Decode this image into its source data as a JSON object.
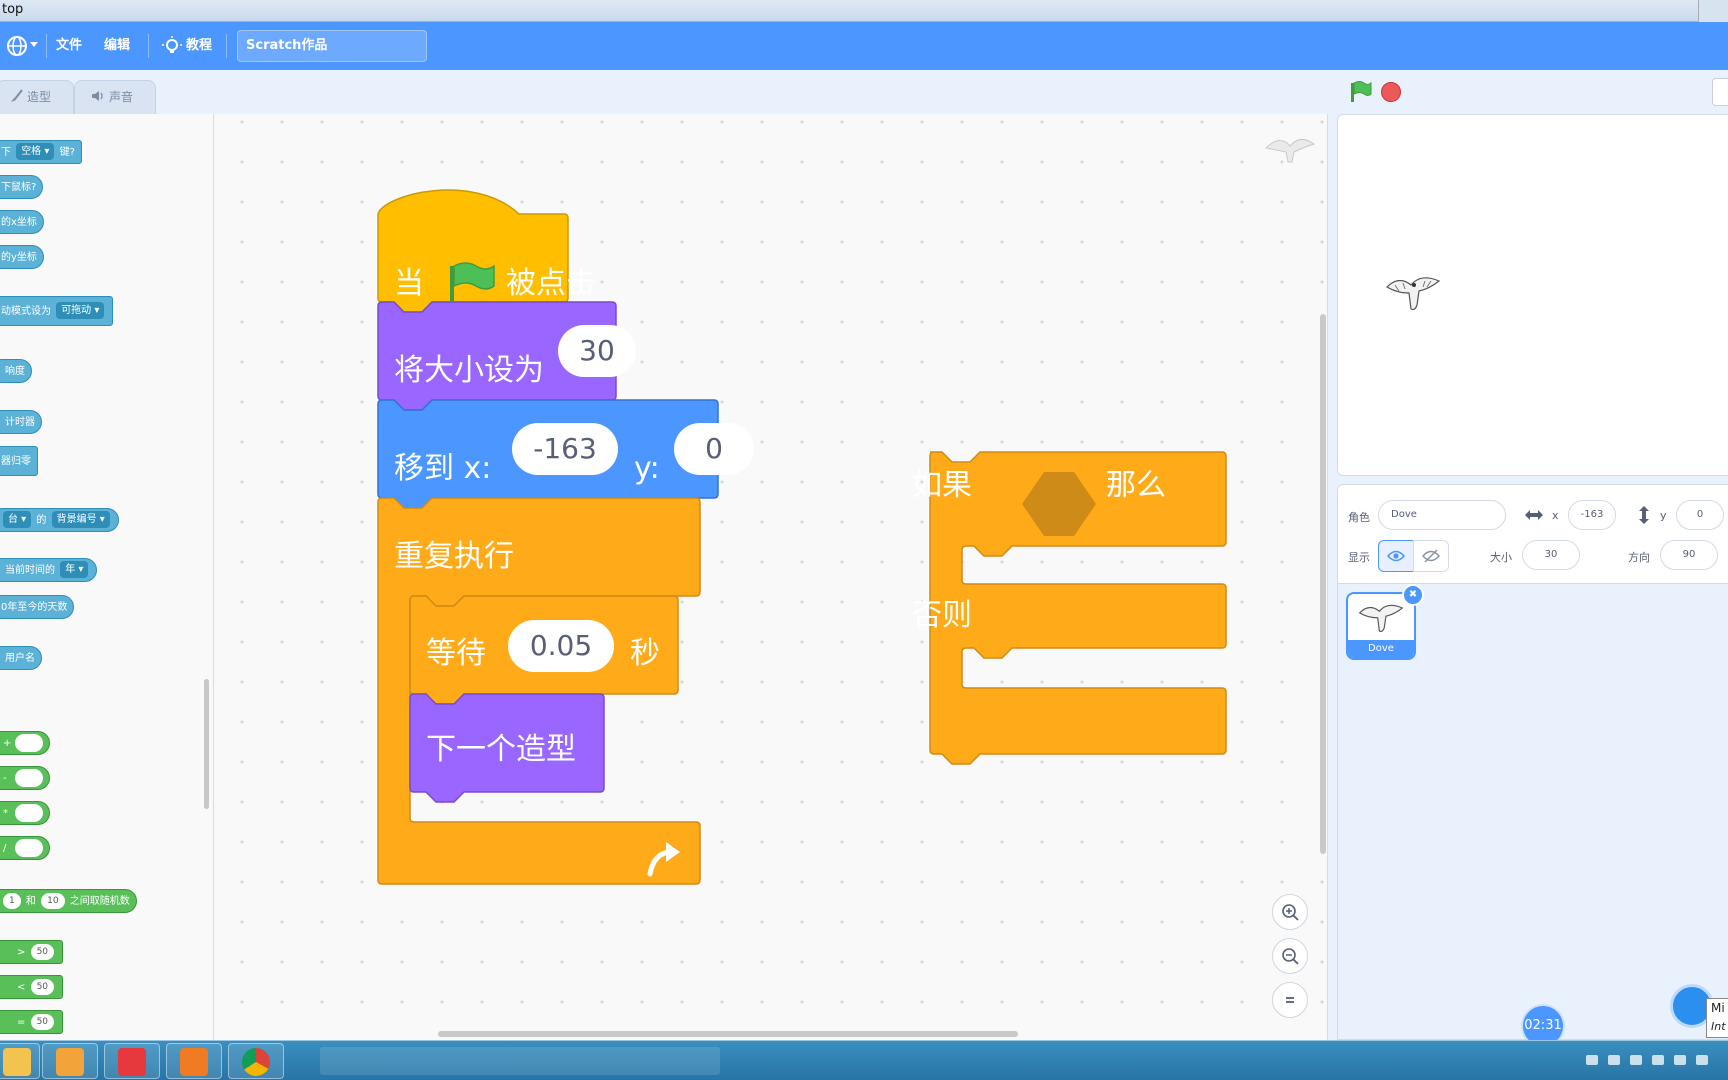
{
  "window": {
    "title": "top"
  },
  "menubar": {
    "file": "文件",
    "edit": "编辑",
    "tutorials": "教程",
    "project_title": "Scratch作品"
  },
  "tabs": {
    "costumes": "造型",
    "sounds": "声音"
  },
  "palette": {
    "key_pressed": {
      "prefix": "下",
      "key": "空格",
      "suffix": "键?"
    },
    "mouse_down": "下鼠标?",
    "mouse_x": "的x坐标",
    "mouse_y": "的y坐标",
    "drag_mode": {
      "text": "动模式设为",
      "value": "可拖动"
    },
    "loudness": "响度",
    "timer": "计时器",
    "reset_timer": "器归零",
    "backdrop_of": {
      "prefix": "台",
      "mid": "的",
      "value": "背景编号"
    },
    "current": {
      "text": "当前时间的",
      "value": "年"
    },
    "days_since": "0年至今的天数",
    "username": "用户名",
    "op_add": "+",
    "op_sub": "-",
    "op_mul": "*",
    "op_div": "/",
    "random": {
      "from": "1",
      "and": "和",
      "to": "10",
      "suffix": "之间取随机数"
    },
    "gt": {
      "op": ">",
      "value": "50"
    },
    "lt": {
      "op": "<",
      "value": "50"
    },
    "eq": {
      "op": "=",
      "value": "50"
    }
  },
  "script": {
    "hat": {
      "when": "当",
      "clicked": "被点击"
    },
    "set_size": {
      "label": "将大小设为",
      "value": "30"
    },
    "goto": {
      "label": "移到 x:",
      "x": "-163",
      "ylabel": "y:",
      "y": "0"
    },
    "forever": {
      "label": "重复执行"
    },
    "wait": {
      "label": "等待",
      "value": "0.05",
      "unit": "秒"
    },
    "next_costume": {
      "label": "下一个造型"
    }
  },
  "ifelse": {
    "if": "如果",
    "then": "那么",
    "else": "否则"
  },
  "sprite_info": {
    "sprite_label": "角色",
    "sprite_name": "Dove",
    "x_label": "x",
    "x": "-163",
    "y_label": "y",
    "y": "0",
    "show_label": "显示",
    "size_label": "大小",
    "size": "30",
    "direction_label": "方向",
    "direction": "90"
  },
  "sprite_card": {
    "name": "Dove"
  },
  "timer": "02:31",
  "mini_popup": {
    "line1": "Mi",
    "line2": "Int"
  },
  "colors": {
    "menu": "#4c97ff",
    "events": "#ffbf00",
    "looks": "#9966ff",
    "motion": "#4c97ff",
    "control": "#ffab19",
    "sensing": "#5cb1d6",
    "operators": "#59c059"
  }
}
